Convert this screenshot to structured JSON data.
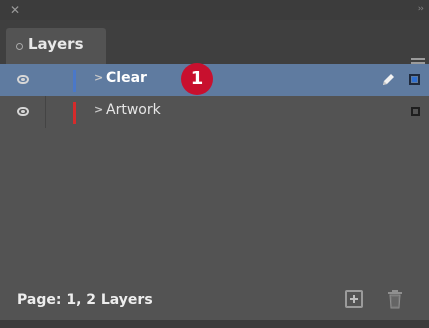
{
  "window": {
    "close_icon": "close-icon",
    "collapse_icon": "collapse-icon"
  },
  "tab": {
    "label": "Layers",
    "grip_icon": "grip-icon"
  },
  "panel_menu_icon": "hamburger-menu-icon",
  "layers": [
    {
      "name": "Clear",
      "selected": true,
      "visible": true,
      "color": "#4a78c9",
      "badge": "1",
      "locked_edit_icon": "pen-icon",
      "target_icon": "target-square-icon"
    },
    {
      "name": "Artwork",
      "selected": false,
      "visible": true,
      "color": "#d62b2b",
      "target_icon": "target-square-icon"
    }
  ],
  "footer": {
    "status": "Page: 1, 2 Layers",
    "new_layer_icon": "new-layer-icon",
    "delete_icon": "trash-icon"
  },
  "colors": {
    "panel_bg": "#535353",
    "selection_bg": "#5f7ba0",
    "badge_red": "#c8102e"
  }
}
